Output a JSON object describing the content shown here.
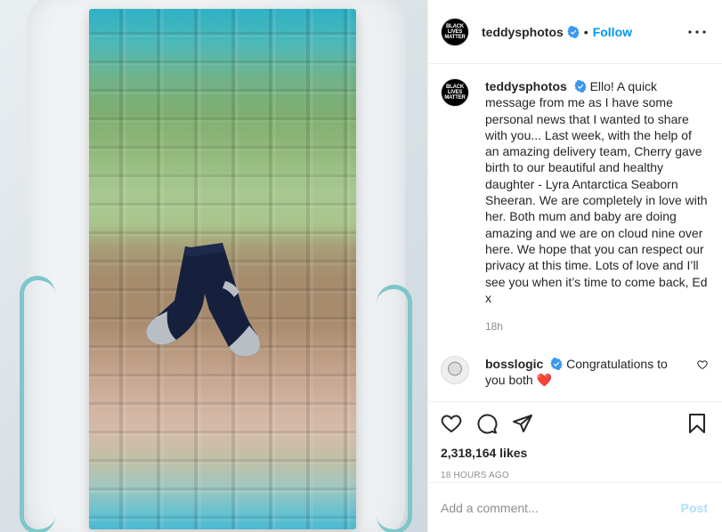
{
  "post": {
    "image_alt": "Knitted gradient baby blanket with a pair of navy and grey baby socks",
    "author": "teddysphotos",
    "avatar_text": "BLACK\nLIVES\nMATTER",
    "follow_label": "Follow",
    "dot": "•",
    "more_icon": "more-horizontal-icon",
    "caption": {
      "username": "teddysphotos",
      "text": "Ello! A quick message from me as I have some personal news that I wanted to share with you... Last week, with the help of an amazing delivery team, Cherry gave birth to our beautiful and healthy daughter - Lyra Antarctica Seaborn Sheeran. We are completely in love with her. Both mum and baby are doing amazing and we are on cloud nine over here. We hope that you can respect our privacy at this time. Lots of love and I’ll see you when it’s time to come back, Ed x",
      "time": "18h"
    },
    "comments": [
      {
        "username": "bosslogic",
        "text": "Congratulations to you both",
        "emoji": "❤️"
      }
    ],
    "likes": "2,318,164 likes",
    "timestamp": "18 HOURS AGO",
    "comment_placeholder": "Add a comment...",
    "post_label": "Post",
    "colors": {
      "accent": "#0095f6",
      "post_disabled": "#b2dffc",
      "heart": "#ed4956",
      "muted": "#8e8e8e"
    }
  }
}
